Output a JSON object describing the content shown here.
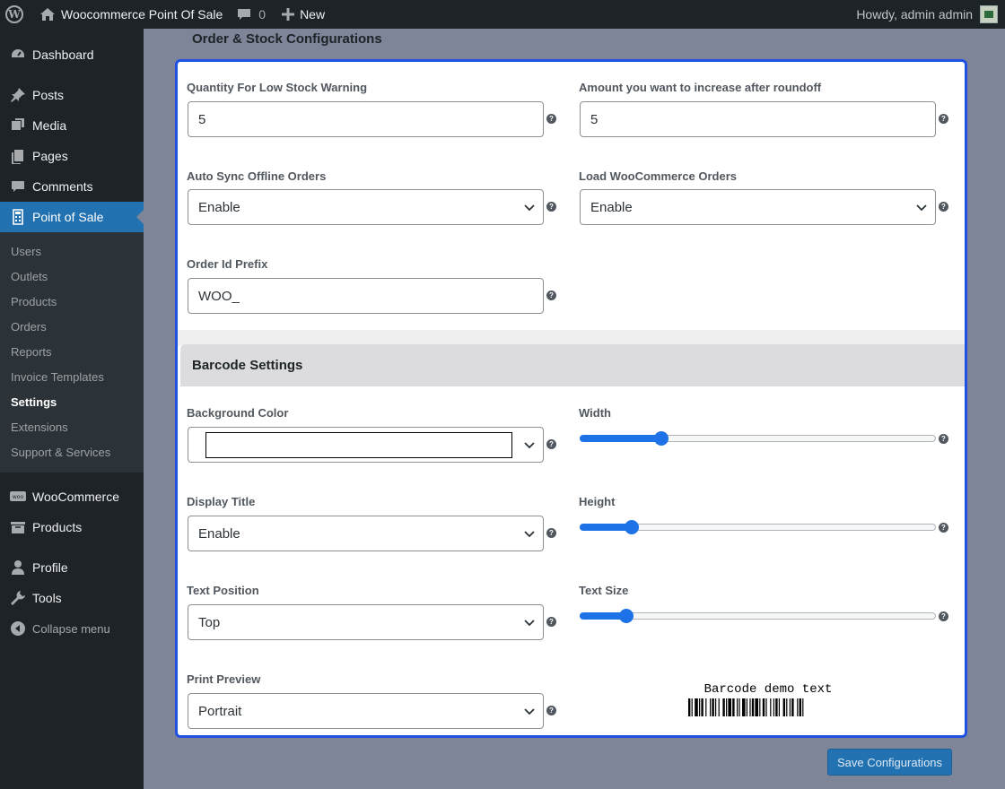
{
  "adminbar": {
    "site_name": "Woocommerce Point Of Sale",
    "comments_count": "0",
    "new_label": "New",
    "greeting": "Howdy, admin admin"
  },
  "sidebar": {
    "items": [
      {
        "label": "Dashboard",
        "icon": "dashboard-icon"
      },
      {
        "label": "Posts",
        "icon": "pin-icon"
      },
      {
        "label": "Media",
        "icon": "media-icon"
      },
      {
        "label": "Pages",
        "icon": "pages-icon"
      },
      {
        "label": "Comments",
        "icon": "comment-icon"
      },
      {
        "label": "Point of Sale",
        "icon": "calculator-icon"
      }
    ],
    "submenu": [
      "Users",
      "Outlets",
      "Products",
      "Orders",
      "Reports",
      "Invoice Templates",
      "Settings",
      "Extensions",
      "Support & Services"
    ],
    "current_submenu": "Settings",
    "items2": [
      {
        "label": "WooCommerce",
        "icon": "woo-icon"
      },
      {
        "label": "Products",
        "icon": "archive-icon"
      },
      {
        "label": "Profile",
        "icon": "user-icon"
      },
      {
        "label": "Tools",
        "icon": "wrench-icon"
      }
    ],
    "collapse_label": "Collapse menu"
  },
  "section_title": "Order & Stock Configurations",
  "order_stock": {
    "low_stock": {
      "label": "Quantity For Low Stock Warning",
      "value": "5"
    },
    "roundoff": {
      "label": "Amount you want to increase after roundoff",
      "value": "5"
    },
    "auto_sync": {
      "label": "Auto Sync Offline Orders",
      "value": "Enable"
    },
    "load_orders": {
      "label": "Load WooCommerce Orders",
      "value": "Enable"
    },
    "order_prefix": {
      "label": "Order Id Prefix",
      "value": "WOO_"
    }
  },
  "barcode": {
    "title": "Barcode Settings",
    "background_color": {
      "label": "Background Color",
      "value": "#ffffff"
    },
    "width": {
      "label": "Width",
      "fraction": 0.23
    },
    "display_title": {
      "label": "Display Title",
      "value": "Enable"
    },
    "height": {
      "label": "Height",
      "fraction": 0.145
    },
    "text_position": {
      "label": "Text Position",
      "value": "Top"
    },
    "text_size": {
      "label": "Text Size",
      "fraction": 0.13
    },
    "print_preview": {
      "label": "Print Preview",
      "value": "Portrait"
    },
    "demo_text": "Barcode demo text"
  },
  "save_button": "Save Configurations",
  "help_glyph": "?",
  "colors": {
    "accent": "#2271b1",
    "panel_border": "#2151e3",
    "slider": "#1d72e8"
  }
}
